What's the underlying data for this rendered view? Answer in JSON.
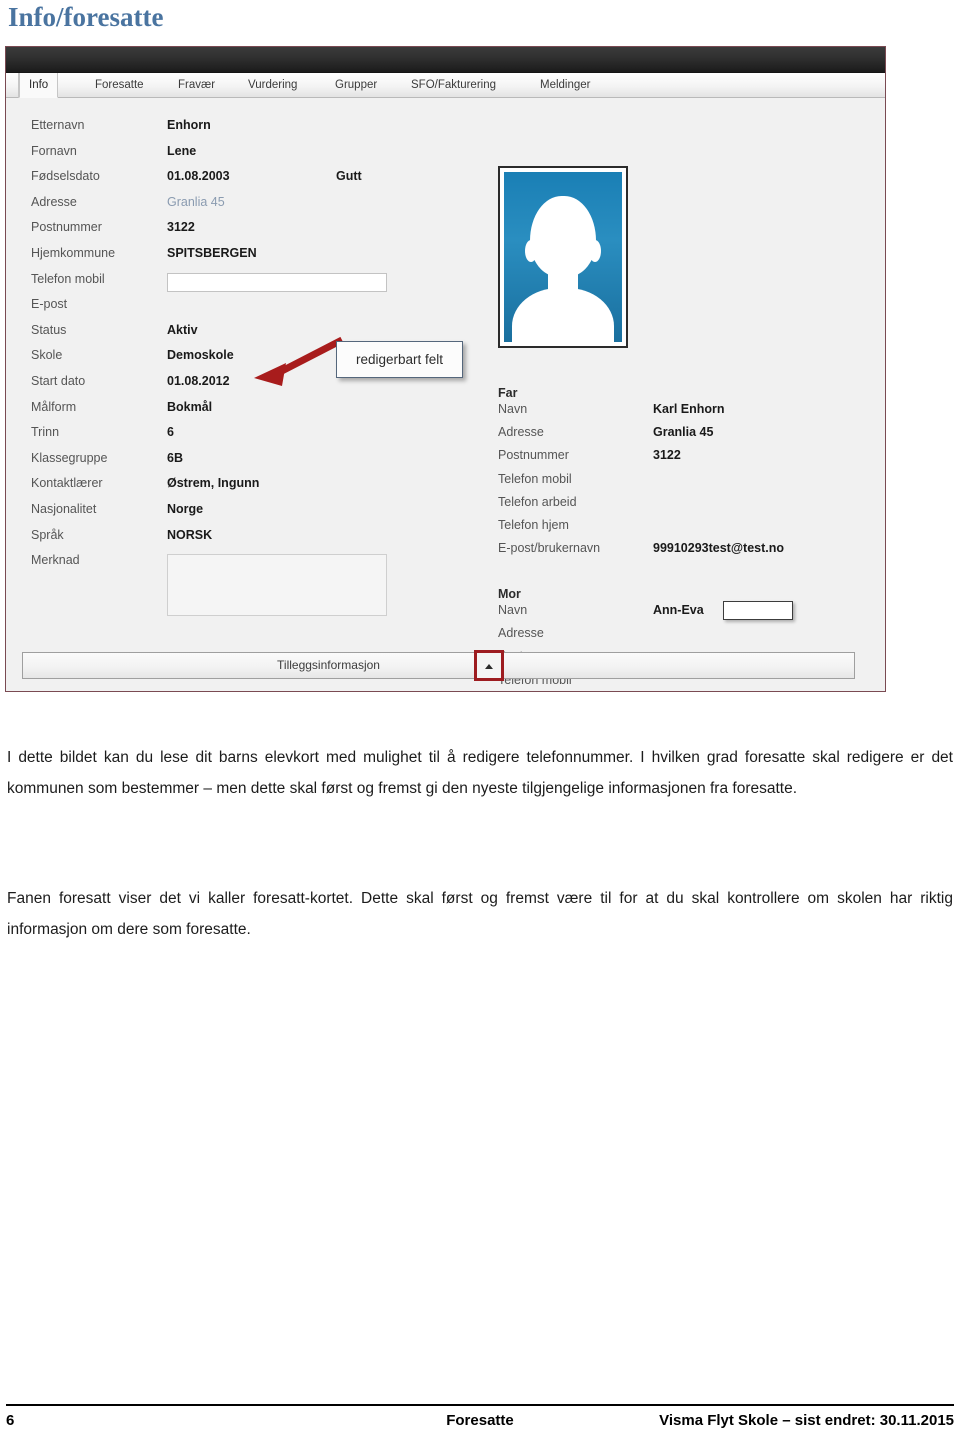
{
  "page": {
    "title": "Info/foresatte"
  },
  "screenshot": {
    "tabs": [
      {
        "label": "Info",
        "active": true
      },
      {
        "label": "Foresatte",
        "active": false
      },
      {
        "label": "Fravær",
        "active": false
      },
      {
        "label": "Vurdering",
        "active": false
      },
      {
        "label": "Grupper",
        "active": false
      },
      {
        "label": "SFO/Fakturering",
        "active": false
      },
      {
        "label": "Meldinger",
        "active": false
      }
    ],
    "student_fields": [
      {
        "label": "Etternavn",
        "value": "Enhorn",
        "style": "bold"
      },
      {
        "label": "Fornavn",
        "value": "Lene",
        "style": "bold"
      },
      {
        "label": "Fødselsdato",
        "value": "01.08.2003",
        "style": "bold",
        "value2": "Gutt"
      },
      {
        "label": "Adresse",
        "value": "Granlia 45",
        "style": "muted"
      },
      {
        "label": "Postnummer",
        "value": "3122",
        "style": "bold"
      },
      {
        "label": "Hjemkommune",
        "value": "SPITSBERGEN",
        "style": "bold"
      },
      {
        "label": "Telefon mobil",
        "value": "",
        "style": "input"
      },
      {
        "label": "E-post",
        "value": "",
        "style": "bold"
      },
      {
        "label": "Status",
        "value": "Aktiv",
        "style": "bold"
      },
      {
        "label": "Skole",
        "value": "Demoskole",
        "style": "bold"
      },
      {
        "label": "Start dato",
        "value": "01.08.2012",
        "style": "bold"
      },
      {
        "label": "Målform",
        "value": "Bokmål",
        "style": "bold"
      },
      {
        "label": "Trinn",
        "value": "6",
        "style": "bold"
      },
      {
        "label": "Klassegruppe",
        "value": "6B",
        "style": "bold"
      },
      {
        "label": "Kontaktlærer",
        "value": "Østrem, Ingunn",
        "style": "bold"
      },
      {
        "label": "Nasjonalitet",
        "value": "Norge",
        "style": "bold"
      },
      {
        "label": "Språk",
        "value": "NORSK",
        "style": "bold"
      },
      {
        "label": "Merknad",
        "value": "",
        "style": "textarea"
      }
    ],
    "father": {
      "title": "Far",
      "fields": [
        {
          "label": "Navn",
          "value": "Karl Enhorn"
        },
        {
          "label": "Adresse",
          "value": "Granlia 45"
        },
        {
          "label": "Postnummer",
          "value": "3122"
        },
        {
          "label": "Telefon mobil",
          "value": ""
        },
        {
          "label": "Telefon arbeid",
          "value": ""
        },
        {
          "label": "Telefon hjem",
          "value": ""
        },
        {
          "label": "E-post/brukernavn",
          "value": "99910293test@test.no"
        }
      ]
    },
    "mother": {
      "title": "Mor",
      "fields": [
        {
          "label": "Navn",
          "value": "Ann-Eva",
          "redacted": true
        },
        {
          "label": "Adresse",
          "value": ""
        },
        {
          "label": "Postnummer",
          "value": ""
        },
        {
          "label": "Telefon mobil",
          "value": ""
        }
      ]
    },
    "expander": {
      "label": "Tilleggsinformasjon",
      "caret": "collapse-up-caret"
    },
    "callout": {
      "text": "redigerbart felt",
      "arrow_color": "#a81c1c"
    },
    "avatar": {
      "alt": "student-photo-placeholder",
      "background_color": "#1f82b8"
    }
  },
  "body_text": {
    "paragraph1": "I dette bildet kan du lese dit barns elevkort med mulighet til å redigere telefonnummer. I hvilken grad foresatte skal redigere er det kommunen som bestemmer – men dette skal først og fremst gi den nyeste tilgjengelige informasjonen fra foresatte.",
    "paragraph2": "Fanen foresatt viser det vi kaller foresatt-kortet. Dette skal først og fremst være til for at du skal kontrollere om skolen har riktig informasjon om dere som foresatte."
  },
  "footer": {
    "page_number": "6",
    "center": "Foresatte",
    "right": "Visma Flyt Skole – sist endret: 30.11.2015"
  },
  "colors": {
    "heading": "#4a74a0",
    "highlight": "#9d1c20",
    "muted_value": "#8a9bb0"
  }
}
